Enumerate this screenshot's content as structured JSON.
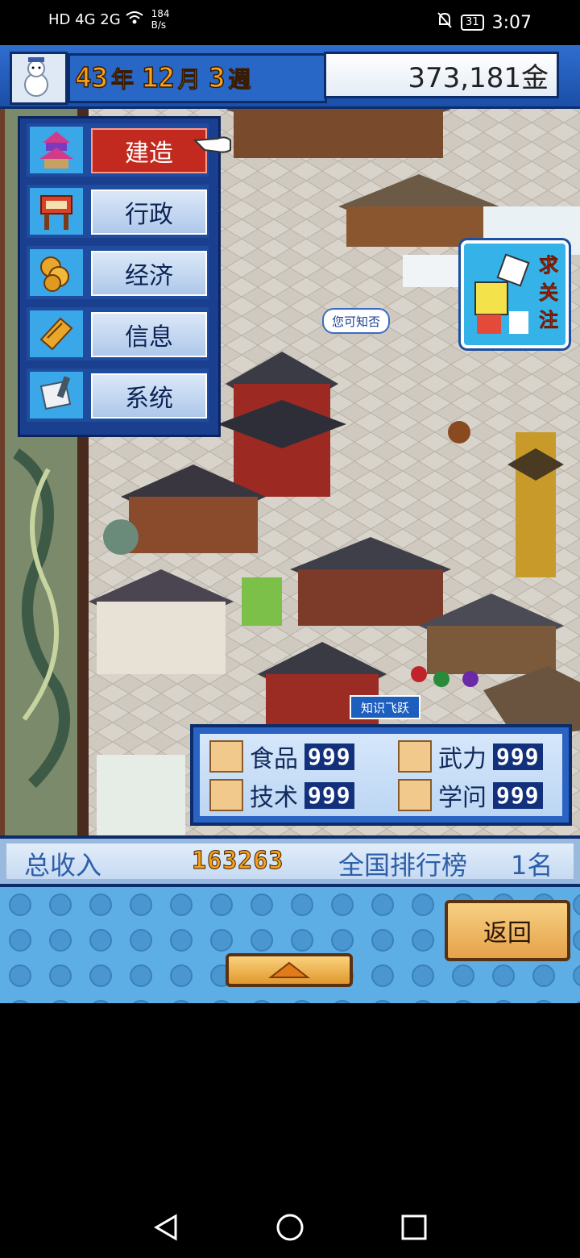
{
  "status_bar": {
    "network": "HD 4G 2G",
    "speed_value": "184",
    "speed_unit": "B/s",
    "battery": "31",
    "time": "3:07"
  },
  "header": {
    "year": "43",
    "year_unit": "年",
    "month": "12",
    "month_unit": "月",
    "week": "3",
    "week_unit": "週",
    "gold": "373,181金"
  },
  "menu": {
    "items": [
      {
        "label": "建造",
        "icon": "pagoda-icon"
      },
      {
        "label": "行政",
        "icon": "signboard-icon"
      },
      {
        "label": "经济",
        "icon": "coins-icon"
      },
      {
        "label": "信息",
        "icon": "scroll-icon"
      },
      {
        "label": "系统",
        "icon": "paper-icon"
      }
    ]
  },
  "badges": {
    "request_attention": "求关注",
    "did_you_know": "您可知否",
    "knowledge": "知识飞跃"
  },
  "stats": {
    "food_label": "食品",
    "food_value": "999",
    "force_label": "武力",
    "force_value": "999",
    "tech_label": "技术",
    "tech_value": "999",
    "learning_label": "学问",
    "learning_value": "999"
  },
  "income": {
    "label": "总收入",
    "value": "163263",
    "rank_label": "全国排行榜",
    "rank_value": "1名"
  },
  "buttons": {
    "return": "返回"
  },
  "colors": {
    "menu_active": "#c22a1f",
    "panel_blue": "#2a63c4",
    "gold_text": "#f6a21c"
  }
}
